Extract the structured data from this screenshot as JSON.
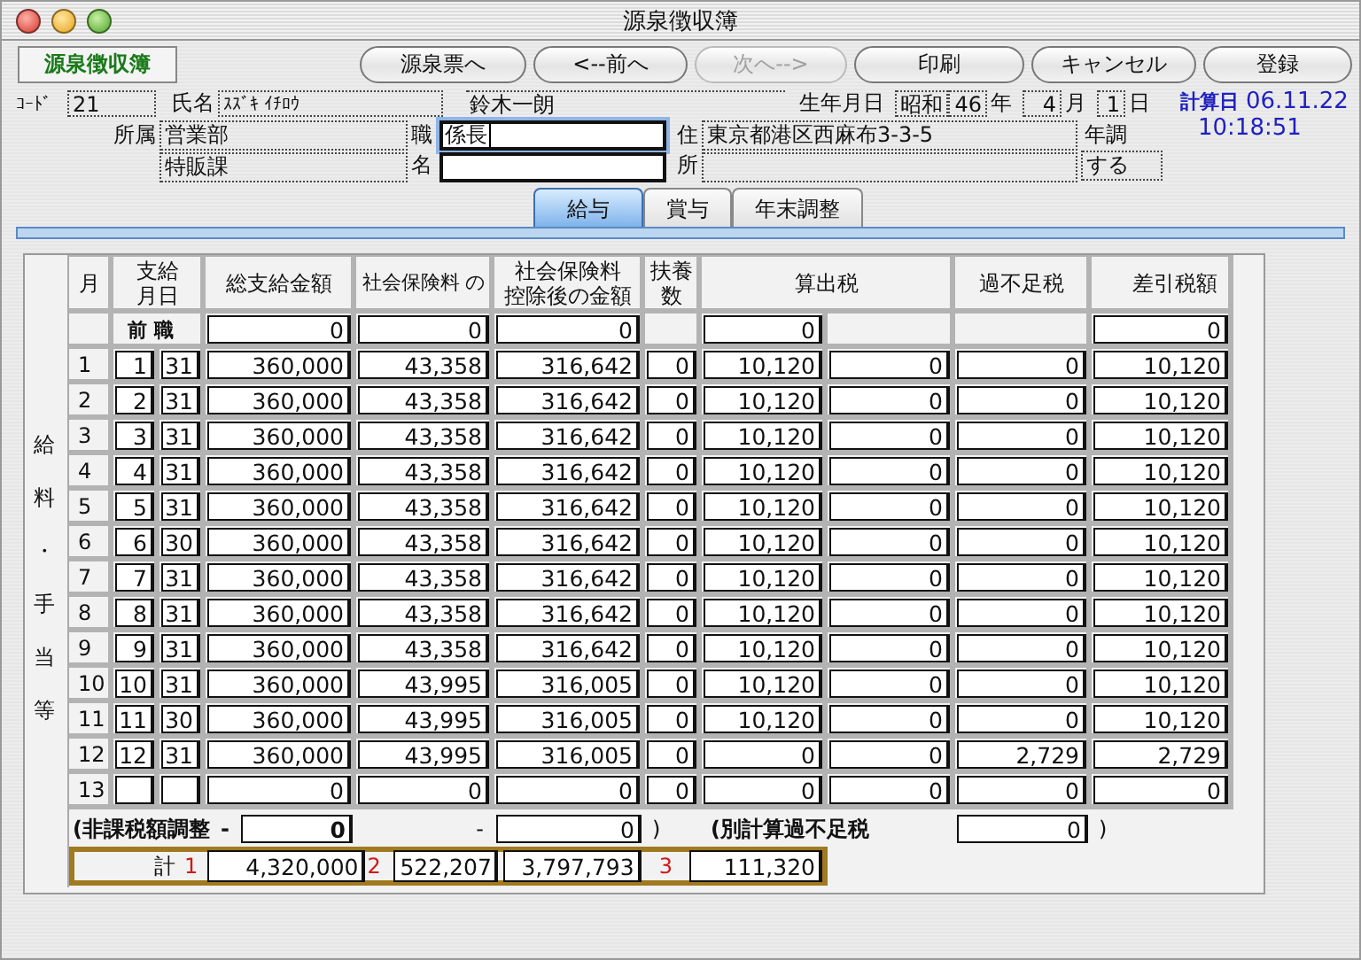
{
  "window": {
    "title": "源泉徴収簿"
  },
  "header_label": "源泉徴収簿",
  "buttons": [
    {
      "label": "源泉票へ",
      "disabled": false
    },
    {
      "label": "<--前へ",
      "disabled": false
    },
    {
      "label": "次へ-->",
      "disabled": true
    },
    {
      "label": "印刷",
      "disabled": false
    },
    {
      "label": "キャンセル",
      "disabled": false
    },
    {
      "label": "登録",
      "disabled": false
    }
  ],
  "employee": {
    "code_label": "ｺｰﾄﾞ",
    "code": "21",
    "name_label": "氏名",
    "name_kana": "ｽｽﾞｷ ｲﾁﾛｳ",
    "name": "鈴木一朗",
    "birth_label": "生年月日",
    "birth_era": "昭和",
    "birth_year": "46",
    "year_unit": "年",
    "birth_month": "4",
    "month_unit": "月",
    "birth_day": "1",
    "day_unit": "日",
    "calc_date_label": "計算日",
    "calc_date": "06.11.22",
    "calc_time": "10:18:51",
    "department_label": "所属",
    "department": [
      "営業部",
      "特販課"
    ],
    "position_label": [
      "職",
      "名"
    ],
    "position": "係長",
    "address_label": [
      "住",
      "所"
    ],
    "address": "東京都港区西麻布3-3-5",
    "year_adjust_label": "年調",
    "year_adjust": "する"
  },
  "tabs": [
    {
      "label": "給与",
      "selected": true
    },
    {
      "label": "賞与",
      "selected": false
    },
    {
      "label": "年末調整",
      "selected": false
    }
  ],
  "table": {
    "side_label": "給料・手当等",
    "columns": [
      {
        "lines": [
          "月"
        ]
      },
      {
        "lines": [
          "支給",
          "月日"
        ]
      },
      {
        "lines": [
          "総支給金額"
        ]
      },
      {
        "lines": [
          "社会保険料 の"
        ]
      },
      {
        "lines": [
          "社会保険料",
          "控除後の金額"
        ]
      },
      {
        "lines": [
          "扶養",
          "数"
        ]
      },
      {
        "lines": [
          "算出税"
        ]
      },
      {
        "lines": [
          "過不足税"
        ]
      },
      {
        "lines": [
          "差引税額"
        ]
      }
    ],
    "previous_job": {
      "label": "前 職",
      "gross": "0",
      "social_insurance": "0",
      "after_deduction": "0",
      "tax": "0",
      "net_tax": "0"
    },
    "rows": [
      {
        "month": "1",
        "pay_month": "1",
        "pay_day": "31",
        "gross": "360,000",
        "social_insurance": "43,358",
        "after_deduction": "316,642",
        "dependents": "0",
        "tax": "10,120",
        "tax_2": "0",
        "over_under": "0",
        "net_tax": "10,120"
      },
      {
        "month": "2",
        "pay_month": "2",
        "pay_day": "31",
        "gross": "360,000",
        "social_insurance": "43,358",
        "after_deduction": "316,642",
        "dependents": "0",
        "tax": "10,120",
        "tax_2": "0",
        "over_under": "0",
        "net_tax": "10,120"
      },
      {
        "month": "3",
        "pay_month": "3",
        "pay_day": "31",
        "gross": "360,000",
        "social_insurance": "43,358",
        "after_deduction": "316,642",
        "dependents": "0",
        "tax": "10,120",
        "tax_2": "0",
        "over_under": "0",
        "net_tax": "10,120"
      },
      {
        "month": "4",
        "pay_month": "4",
        "pay_day": "31",
        "gross": "360,000",
        "social_insurance": "43,358",
        "after_deduction": "316,642",
        "dependents": "0",
        "tax": "10,120",
        "tax_2": "0",
        "over_under": "0",
        "net_tax": "10,120"
      },
      {
        "month": "5",
        "pay_month": "5",
        "pay_day": "31",
        "gross": "360,000",
        "social_insurance": "43,358",
        "after_deduction": "316,642",
        "dependents": "0",
        "tax": "10,120",
        "tax_2": "0",
        "over_under": "0",
        "net_tax": "10,120"
      },
      {
        "month": "6",
        "pay_month": "6",
        "pay_day": "30",
        "gross": "360,000",
        "social_insurance": "43,358",
        "after_deduction": "316,642",
        "dependents": "0",
        "tax": "10,120",
        "tax_2": "0",
        "over_under": "0",
        "net_tax": "10,120"
      },
      {
        "month": "7",
        "pay_month": "7",
        "pay_day": "31",
        "gross": "360,000",
        "social_insurance": "43,358",
        "after_deduction": "316,642",
        "dependents": "0",
        "tax": "10,120",
        "tax_2": "0",
        "over_under": "0",
        "net_tax": "10,120"
      },
      {
        "month": "8",
        "pay_month": "8",
        "pay_day": "31",
        "gross": "360,000",
        "social_insurance": "43,358",
        "after_deduction": "316,642",
        "dependents": "0",
        "tax": "10,120",
        "tax_2": "0",
        "over_under": "0",
        "net_tax": "10,120"
      },
      {
        "month": "9",
        "pay_month": "9",
        "pay_day": "31",
        "gross": "360,000",
        "social_insurance": "43,358",
        "after_deduction": "316,642",
        "dependents": "0",
        "tax": "10,120",
        "tax_2": "0",
        "over_under": "0",
        "net_tax": "10,120"
      },
      {
        "month": "10",
        "pay_month": "10",
        "pay_day": "31",
        "gross": "360,000",
        "social_insurance": "43,995",
        "after_deduction": "316,005",
        "dependents": "0",
        "tax": "10,120",
        "tax_2": "0",
        "over_under": "0",
        "net_tax": "10,120"
      },
      {
        "month": "11",
        "pay_month": "11",
        "pay_day": "30",
        "gross": "360,000",
        "social_insurance": "43,995",
        "after_deduction": "316,005",
        "dependents": "0",
        "tax": "10,120",
        "tax_2": "0",
        "over_under": "0",
        "net_tax": "10,120"
      },
      {
        "month": "12",
        "pay_month": "12",
        "pay_day": "31",
        "gross": "360,000",
        "social_insurance": "43,995",
        "after_deduction": "316,005",
        "dependents": "0",
        "tax": "0",
        "tax_2": "0",
        "over_under": "2,729",
        "net_tax": "2,729"
      },
      {
        "month": "13",
        "gross": "0",
        "social_insurance": "0",
        "after_deduction": "0",
        "dependents": "0",
        "tax": "0",
        "tax_2": "0",
        "over_under": "0",
        "net_tax": "0"
      }
    ],
    "adjustment": {
      "label": "(非課税額調整",
      "minus_1": "-",
      "value_1": "0",
      "minus_2": "-",
      "value_2": "0",
      "close": ")",
      "separate_label": "(別計算過不足税",
      "separate_value": "0",
      "separate_close": ")"
    },
    "totals": {
      "label": "計",
      "mark_1": "1",
      "gross": "4,320,000",
      "mark_2": "2",
      "social_insurance": "522,207",
      "after_deduction": "3,797,793",
      "mark_3": "3",
      "tax": "111,320"
    }
  }
}
